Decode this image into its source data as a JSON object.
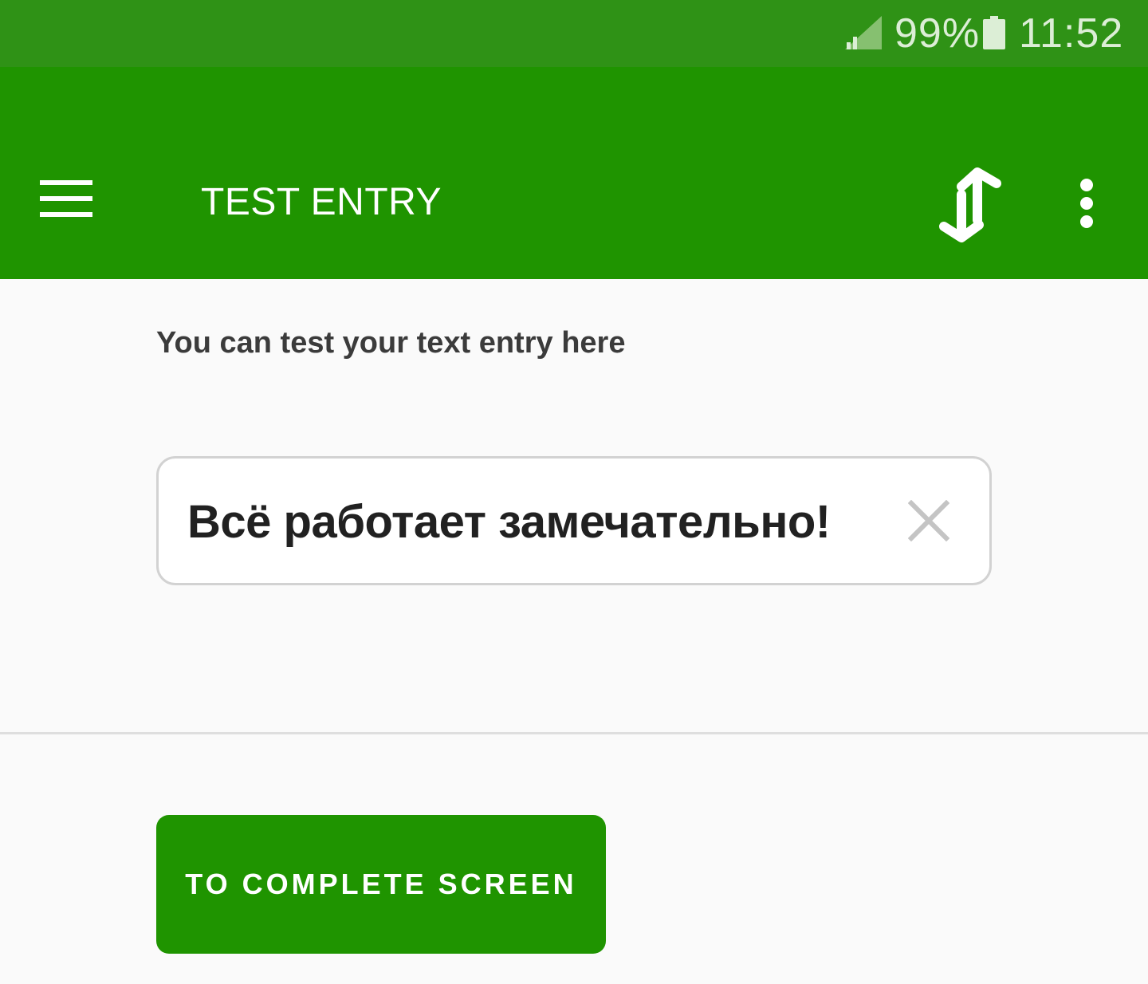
{
  "status_bar": {
    "battery_percent": "99%",
    "time": "11:52",
    "icons": [
      "signal-icon",
      "battery-icon"
    ]
  },
  "app_bar": {
    "title": "TEST ENTRY",
    "icons": [
      "hamburger-menu-icon",
      "swap-vertical-icon",
      "more-vert-icon"
    ]
  },
  "main": {
    "instruction": "You can test your text entry here",
    "entry": {
      "value": "Всё работает замечательно!",
      "clear_icon": "close-icon"
    },
    "complete_button_label": "TO COMPLETE SCREEN"
  },
  "colors": {
    "status_bar": "#2f9216",
    "app_bar": "#1f9400",
    "background": "#fafafa",
    "button": "#1f9400"
  }
}
